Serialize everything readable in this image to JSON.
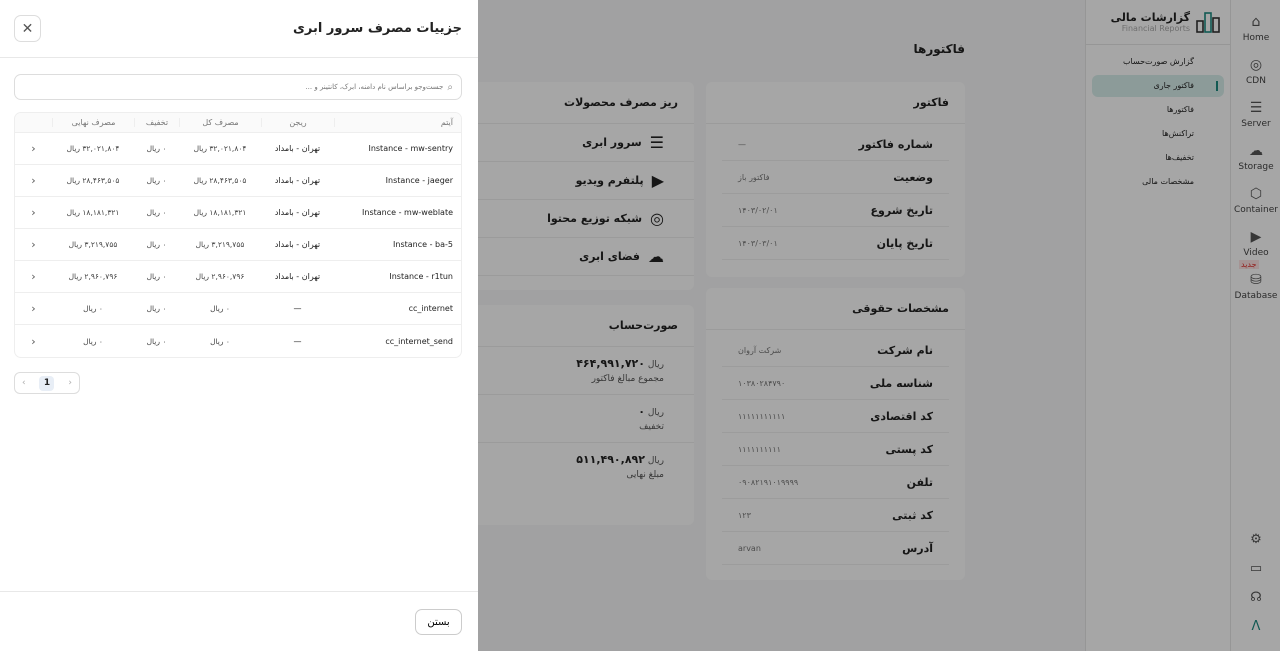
{
  "rail": [
    {
      "label": "Home",
      "icon": "home-icon"
    },
    {
      "label": "CDN",
      "icon": "cdn-icon"
    },
    {
      "label": "Server",
      "icon": "server-icon"
    },
    {
      "label": "Storage",
      "icon": "cloud-upload-icon"
    },
    {
      "label": "Container",
      "icon": "box-icon"
    },
    {
      "label": "Video",
      "icon": "video-icon"
    },
    {
      "label": "Database",
      "icon": "database-icon",
      "badge": "جدید"
    }
  ],
  "rail_bottom": [
    "gear-icon",
    "book-icon",
    "headset-icon",
    "arvan-logo-icon"
  ],
  "sidebar": {
    "title": "گزارشات مالی",
    "subtitle": "Financial Reports",
    "items": [
      "گزارش صورت‌حساب",
      "فاکتور جاری",
      "فاکتورها",
      "تراکنش‌ها",
      "تخفیف‌ها",
      "مشخصات مالی"
    ],
    "active": 1
  },
  "main": {
    "title": "فاکتورها",
    "invoice": {
      "title": "فاکتور",
      "rows": [
        [
          "شماره فاکتور",
          "—"
        ],
        [
          "وضعیت",
          "فاکتور باز"
        ],
        [
          "تاریخ شروع",
          "۱۴۰۳/۰۲/۰۱"
        ],
        [
          "تاریخ پایان",
          "۱۴۰۳/۰۳/۰۱"
        ]
      ]
    },
    "legal": {
      "title": "مشخصات حقوقی",
      "rows": [
        [
          "نام شرکت",
          "شرکت آروان"
        ],
        [
          "شناسه ملی",
          "۱۰۳۸۰۲۸۴۷۹۰"
        ],
        [
          "کد اقتصادی",
          "۱۱۱۱۱۱۱۱۱۱۱"
        ],
        [
          "کد پستی",
          "۱۱۱۱۱۱۱۱۱۱"
        ],
        [
          "تلفن",
          "۰۹۰۸۲۱۹۱۰۱۹۹۹۹"
        ],
        [
          "کد ثبتی",
          "۱۲۳"
        ],
        [
          "آدرس",
          "arvan"
        ]
      ]
    },
    "products": {
      "title": "ریز مصرف محصولات",
      "items": [
        "سرور ابری",
        "پلتفرم ویدیو",
        "شبکه توزیع محتوا",
        "فضای ابری"
      ]
    },
    "statement": {
      "title": "صورت‌حساب",
      "currency": "ریال",
      "total": "۴۶۴,۹۹۱,۷۲۰",
      "total_label": "مجموع مبالغ فاکتور",
      "discount": "۰",
      "discount_label": "تخفیف",
      "final": "۵۱۱,۴۹۰,۸۹۲",
      "final_label": "مبلغ نهایی"
    }
  },
  "drawer": {
    "title": "جزییات مصرف سرور ابری",
    "search_placeholder": "جست‌وجو براساس نام دامنه، ابرک، کانتینر و ...",
    "columns": [
      "آیتم",
      "ریجن",
      "مصرف کل",
      "تخفیف",
      "مصرف نهایی"
    ],
    "rows": [
      [
        "Instance - mw-sentry",
        "تهران - بامداد",
        "۳۲,۰۲۱,۸۰۴ ریال",
        "۰ ریال",
        "۳۲,۰۲۱,۸۰۴ ریال"
      ],
      [
        "Instance - jaeger",
        "تهران - بامداد",
        "۲۸,۴۶۳,۵۰۵ ریال",
        "۰ ریال",
        "۲۸,۴۶۳,۵۰۵ ریال"
      ],
      [
        "Instance - mw-weblate",
        "تهران - بامداد",
        "۱۸,۱۸۱,۳۲۱ ریال",
        "۰ ریال",
        "۱۸,۱۸۱,۳۲۱ ریال"
      ],
      [
        "Instance - ba-5",
        "تهران - بامداد",
        "۳,۲۱۹,۷۵۵ ریال",
        "۰ ریال",
        "۳,۲۱۹,۷۵۵ ریال"
      ],
      [
        "Instance - r1tun",
        "تهران - بامداد",
        "۲,۹۶۰,۷۹۶ ریال",
        "۰ ریال",
        "۲,۹۶۰,۷۹۶ ریال"
      ],
      [
        "cc_internet",
        "—",
        "۰ ریال",
        "۰ ریال",
        "۰ ریال"
      ],
      [
        "cc_internet_send",
        "—",
        "۰ ریال",
        "۰ ریال",
        "۰ ریال"
      ]
    ],
    "page": "1",
    "close_label": "بستن"
  },
  "colors": {
    "accent": "#1c8a80",
    "badge": "#e0322f"
  }
}
